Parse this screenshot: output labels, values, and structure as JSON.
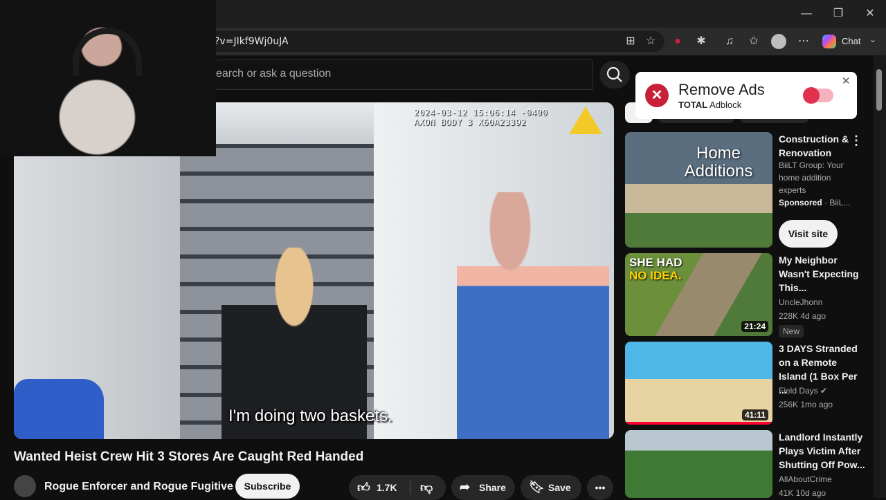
{
  "window": {
    "minimize": "—",
    "maximize": "❐",
    "close": "✕"
  },
  "browser": {
    "url": "?v=JIkf9Wj0uJA",
    "chat_label": "Chat"
  },
  "youtube": {
    "search_placeholder": "earch or ask a question",
    "video": {
      "cam_timestamp": "2024-03-12 15:06:14 -0400",
      "cam_device": "AXON BODY 3  X60A23392",
      "subtitle": "I'm doing two baskets.",
      "title": "Wanted Heist Crew Hit 3 Stores Are Caught Red Handed",
      "channel": "Rogue Enforcer and Rogue Fugitive",
      "subscribe": "Subscribe",
      "likes": "1.7K",
      "share": "Share",
      "save": "Save",
      "more": "•••"
    },
    "ad_popup": {
      "title": "Remove Ads",
      "brand_bold": "TOTAL",
      "brand_rest": " Adblock",
      "close": "✕",
      "toggle_on": false
    },
    "related": [
      {
        "thumb_text": "Home Additions",
        "title": "Construction & Renovation",
        "line1": "BiiLT Group: Your",
        "line2": "home addition",
        "line3": "experts",
        "sponsored": "Sponsored",
        "sponsor_name": "· BiiL...",
        "cta": "Visit site"
      },
      {
        "thumb_text_1": "SHE HAD",
        "thumb_text_2": "NO IDEA.",
        "title": "My Neighbor Wasn't Expecting This...",
        "channel": "UncleJhonn",
        "meta": "228K  4d ago",
        "badge": "New",
        "duration": "21:24"
      },
      {
        "title": "3 DAYS Stranded on a Remote Island (1 Box Per ...",
        "channel": "Field Days",
        "meta": "256K  1mo ago",
        "duration": "41:11"
      },
      {
        "title": "Landlord Instantly Plays Victim After Shutting Off Pow...",
        "channel": "AllAboutCrime",
        "meta": "41K  10d ago"
      }
    ]
  },
  "colors": {
    "background": "#0f0f0f",
    "accent_red": "#e2304f",
    "progress_red": "#ff0033"
  }
}
